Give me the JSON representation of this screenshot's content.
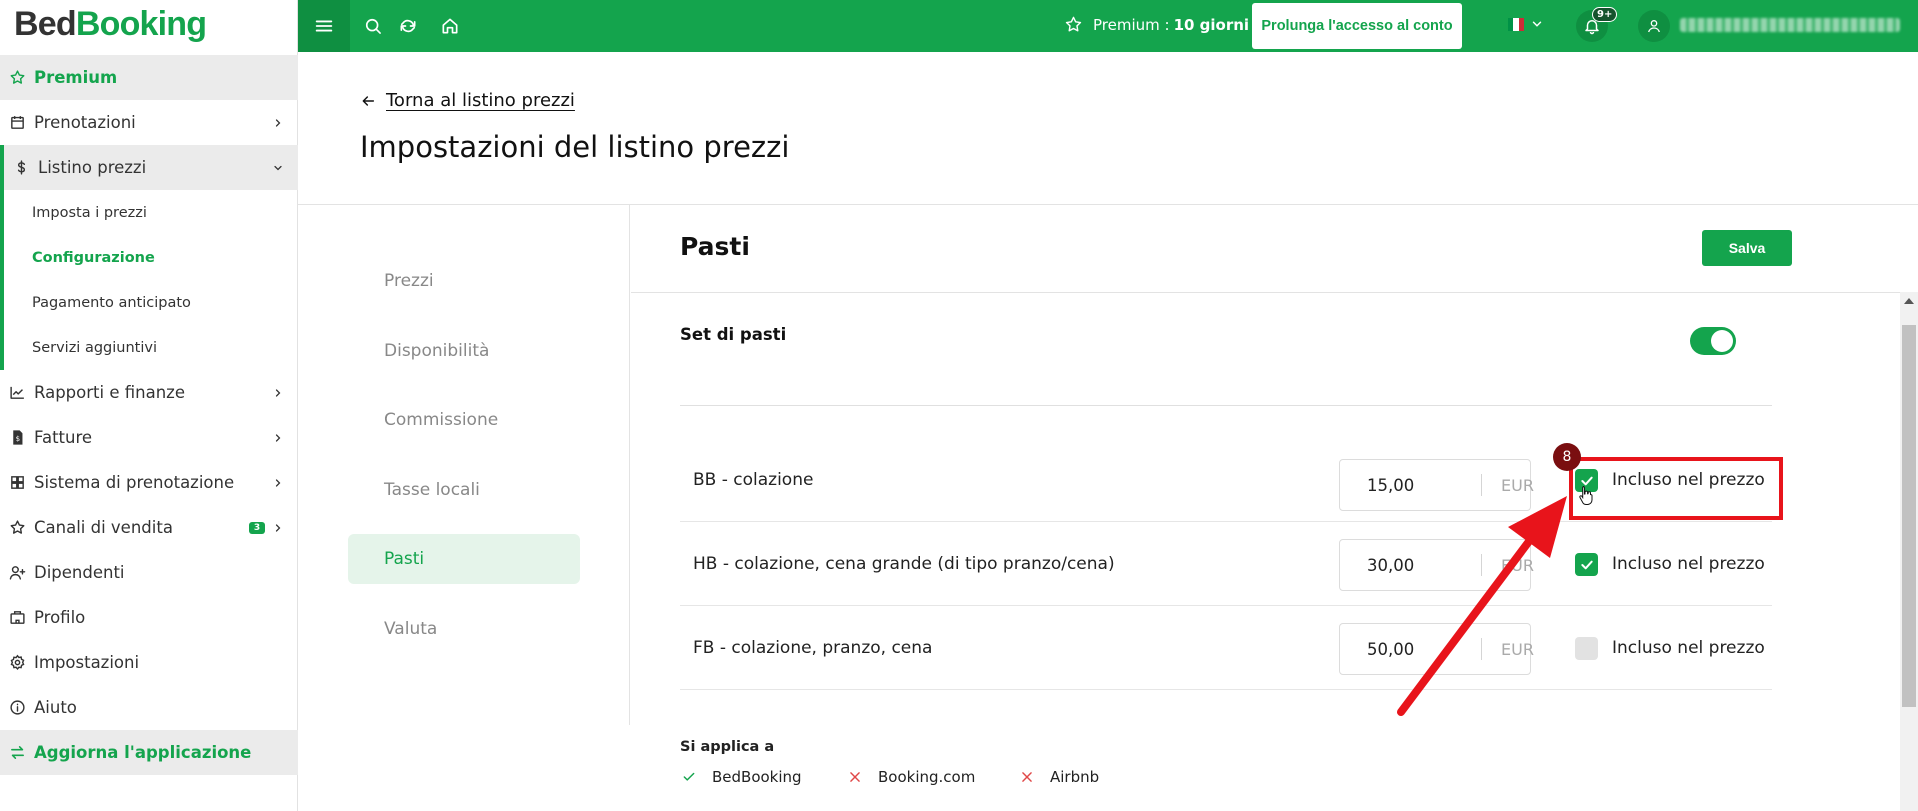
{
  "app": {
    "logo_part1": "Bed",
    "logo_part2": "Booking"
  },
  "topbar": {
    "premium_label": "Premium :",
    "premium_days": "10 giorni",
    "extend_button": "Prolunga l'accesso al conto",
    "notifications_badge": "9+",
    "flag_colors": [
      "#009246",
      "#ffffff",
      "#ce2b37"
    ]
  },
  "sidebar": {
    "premium": "Premium",
    "bookings": "Prenotazioni",
    "price_list": "Listino prezzi",
    "sub_set_prices": "Imposta i prezzi",
    "sub_configuration": "Configurazione",
    "sub_prepayment": "Pagamento anticipato",
    "sub_extra_services": "Servizi aggiuntivi",
    "reports": "Rapporti e finanze",
    "invoices": "Fatture",
    "booking_system": "Sistema di prenotazione",
    "sales_channels": "Canali di vendita",
    "sales_channels_badge": "3",
    "employees": "Dipendenti",
    "profile": "Profilo",
    "settings": "Impostazioni",
    "help": "Aiuto",
    "update_app": "Aggiorna l'applicazione"
  },
  "main": {
    "back_link": "Torna al listino prezzi",
    "page_title": "Impostazioni del listino prezzi"
  },
  "settings_nav": {
    "prices": "Prezzi",
    "availability": "Disponibilità",
    "commission": "Commissione",
    "local_taxes": "Tasse locali",
    "meals": "Pasti",
    "currency": "Valuta"
  },
  "panel": {
    "title": "Pasti",
    "save_button": "Salva",
    "meal_set_label": "Set di pasti",
    "meal_set_enabled": true,
    "meals": [
      {
        "name": "BB - colazione",
        "price": "15,00",
        "currency": "EUR",
        "included": true,
        "included_label": "Incluso nel prezzo"
      },
      {
        "name": "HB - colazione, cena grande (di tipo pranzo/cena)",
        "price": "30,00",
        "currency": "EUR",
        "included": true,
        "included_label": "Incluso nel prezzo"
      },
      {
        "name": "FB - colazione, pranzo, cena",
        "price": "50,00",
        "currency": "EUR",
        "included": false,
        "included_label": "Incluso nel prezzo"
      }
    ],
    "applies_to_label": "Si applica a",
    "channels": [
      {
        "name": "BedBooking",
        "applies": true
      },
      {
        "name": "Booking.com",
        "applies": false
      },
      {
        "name": "Airbnb",
        "applies": false
      }
    ]
  },
  "annotation": {
    "step_number": "8",
    "color": "#e8141b"
  },
  "colors": {
    "brand_green": "#14a44d",
    "selected_nav_bg": "#e5f4ea",
    "red_cross": "#e04848"
  }
}
